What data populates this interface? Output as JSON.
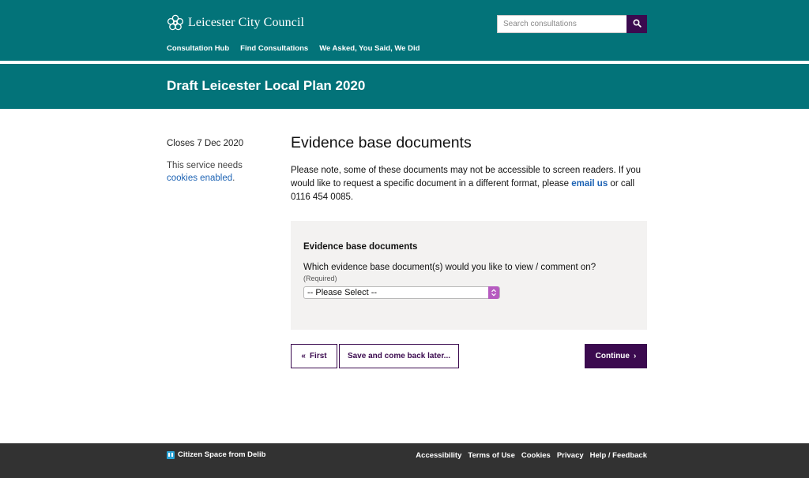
{
  "header": {
    "brand": "Leicester City Council",
    "search_placeholder": "Search consultations",
    "nav": [
      "Consultation Hub",
      "Find Consultations",
      "We Asked, You Said, We Did"
    ]
  },
  "page": {
    "title": "Draft Leicester Local Plan 2020"
  },
  "sidebar": {
    "closes": "Closes 7 Dec 2020",
    "cookie_prefix": "This service needs",
    "cookie_link": "cookies enabled",
    "cookie_suffix": "."
  },
  "main": {
    "title": "Evidence base documents",
    "intro_1": "Please note, some of these documents may not be accessible to screen readers. If you would like to request a specific document in a different format, please ",
    "intro_link": "email us",
    "intro_2": " or call 0116 454 0085."
  },
  "panel": {
    "title": "Evidence base documents",
    "question": "Which evidence base document(s) would you like to view / comment on?",
    "required": "(Required)",
    "select_value": "-- Please Select --"
  },
  "buttons": {
    "first": "First",
    "save": "Save and come back later...",
    "continue": "Continue"
  },
  "footer": {
    "brand": "Citizen Space from Delib",
    "links": [
      "Accessibility",
      "Terms of Use",
      "Cookies",
      "Privacy",
      "Help / Feedback"
    ]
  },
  "colors": {
    "header_teal": "#037379",
    "accent_purple": "#3b0a4f",
    "select_arrow": "#b65bc0",
    "footer_bg": "#323232",
    "link_blue": "#1d63b4"
  }
}
